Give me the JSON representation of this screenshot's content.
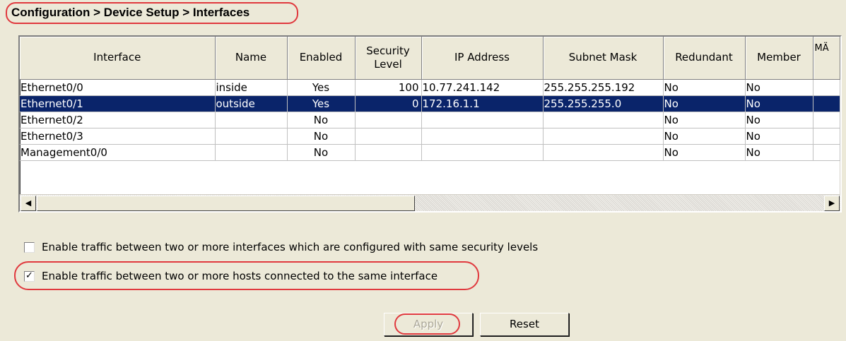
{
  "breadcrumb": "Configuration > Device Setup > Interfaces",
  "table": {
    "columns": [
      "Interface",
      "Name",
      "Enabled",
      "Security\nLevel",
      "IP Address",
      "Subnet Mask",
      "Redundant",
      "Member",
      "MÄ"
    ],
    "rows": [
      {
        "interface": "Ethernet0/0",
        "name": "inside",
        "enabled": "Yes",
        "security_level": "100",
        "ip_address": "10.77.241.142",
        "subnet_mask": "255.255.255.192",
        "redundant": "No",
        "member": "No",
        "selected": false
      },
      {
        "interface": "Ethernet0/1",
        "name": "outside",
        "enabled": "Yes",
        "security_level": "0",
        "ip_address": "172.16.1.1",
        "subnet_mask": "255.255.255.0",
        "redundant": "No",
        "member": "No",
        "selected": true
      },
      {
        "interface": "Ethernet0/2",
        "name": "",
        "enabled": "No",
        "security_level": "",
        "ip_address": "",
        "subnet_mask": "",
        "redundant": "No",
        "member": "No",
        "selected": false
      },
      {
        "interface": "Ethernet0/3",
        "name": "",
        "enabled": "No",
        "security_level": "",
        "ip_address": "",
        "subnet_mask": "",
        "redundant": "No",
        "member": "No",
        "selected": false
      },
      {
        "interface": "Management0/0",
        "name": "",
        "enabled": "No",
        "security_level": "",
        "ip_address": "",
        "subnet_mask": "",
        "redundant": "No",
        "member": "No",
        "selected": false
      }
    ]
  },
  "options": {
    "same_security": {
      "label": "Enable traffic between two or more interfaces which are configured with same security levels",
      "checked": false
    },
    "same_interface": {
      "label": "Enable traffic between two or more hosts connected to the same interface",
      "checked": true
    }
  },
  "buttons": {
    "apply": "Apply",
    "reset": "Reset"
  },
  "icons": {
    "scroll_left": "left-arrow-icon",
    "scroll_right": "right-arrow-icon",
    "check": "checkmark-icon"
  },
  "colors": {
    "selection": "#0a246a",
    "highlight_oval": "#e0393e",
    "panel": "#ece9d8"
  }
}
